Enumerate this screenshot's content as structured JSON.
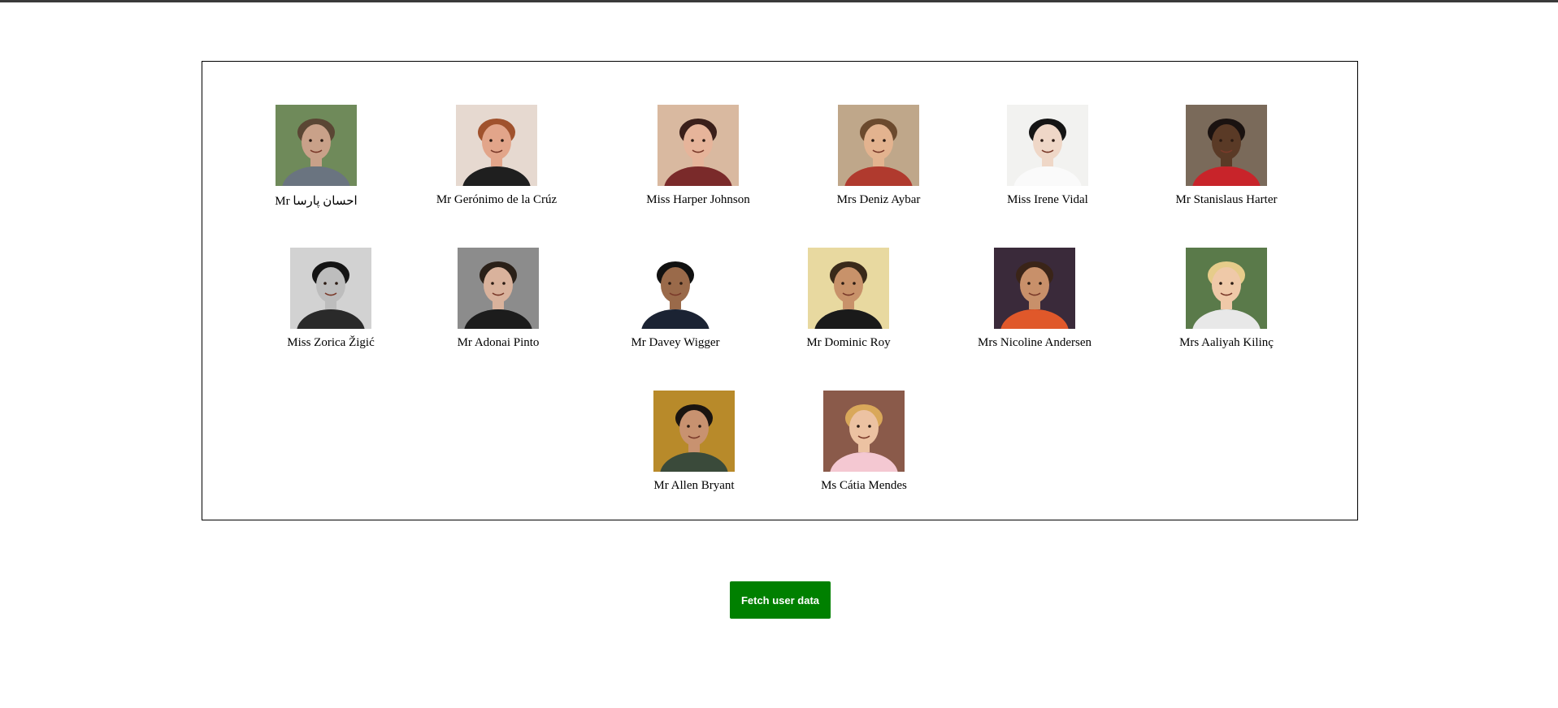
{
  "users": [
    {
      "name": "Mr احسان پارسا",
      "avatar": {
        "bg": "#6f8a5a",
        "skin": "#c9a189",
        "hair": "#5a4634",
        "shirt": "#6a7480"
      }
    },
    {
      "name": "Mr Gerónimo de la Crúz",
      "avatar": {
        "bg": "#e6d9d0",
        "skin": "#e2a58a",
        "hair": "#a0522d",
        "shirt": "#1f1f1f"
      }
    },
    {
      "name": "Miss Harper Johnson",
      "avatar": {
        "bg": "#d9b9a0",
        "skin": "#e6b49a",
        "hair": "#3a1f1a",
        "shirt": "#7a2a2a"
      }
    },
    {
      "name": "Mrs Deniz Aybar",
      "avatar": {
        "bg": "#bfa78a",
        "skin": "#e3b38f",
        "hair": "#6b4a2e",
        "shirt": "#b03a2e"
      }
    },
    {
      "name": "Miss Irene Vidal",
      "avatar": {
        "bg": "#f2f2f0",
        "skin": "#efd7c7",
        "hair": "#151515",
        "shirt": "#fafafa"
      }
    },
    {
      "name": "Mr Stanislaus Harter",
      "avatar": {
        "bg": "#7a6a5a",
        "skin": "#5a3a26",
        "hair": "#1a1210",
        "shirt": "#c8242a"
      }
    },
    {
      "name": "Miss Zorica Žigić",
      "avatar": {
        "bg": "#d2d2d2",
        "skin": "#bdbdbd",
        "hair": "#141414",
        "shirt": "#2a2a2a"
      }
    },
    {
      "name": "Mr Adonai Pinto",
      "avatar": {
        "bg": "#8c8c8c",
        "skin": "#d9b29c",
        "hair": "#2a2018",
        "shirt": "#1c1c1c"
      }
    },
    {
      "name": "Mr Davey Wigger",
      "avatar": {
        "bg": "#ffffff",
        "skin": "#9a6a4a",
        "hair": "#111111",
        "shirt": "#1b2333"
      }
    },
    {
      "name": "Mr Dominic Roy",
      "avatar": {
        "bg": "#e8d9a0",
        "skin": "#c8926a",
        "hair": "#3a2a1a",
        "shirt": "#1a1a1a"
      }
    },
    {
      "name": "Mrs Nicoline Andersen",
      "avatar": {
        "bg": "#3a2a3a",
        "skin": "#c8906a",
        "hair": "#3a2418",
        "shirt": "#e0582a"
      }
    },
    {
      "name": "Mrs Aaliyah Kilinç",
      "avatar": {
        "bg": "#5a7a4a",
        "skin": "#efc9a8",
        "hair": "#e6cc8a",
        "shirt": "#e8e8e8"
      }
    },
    {
      "name": "Mr Allen Bryant",
      "avatar": {
        "bg": "#b88a2a",
        "skin": "#c89270",
        "hair": "#1a1410",
        "shirt": "#3a4a3a"
      }
    },
    {
      "name": "Ms Cátia Mendes",
      "avatar": {
        "bg": "#8a5a4a",
        "skin": "#ecc2a2",
        "hair": "#d9a85a",
        "shirt": "#f4c8d2"
      }
    }
  ],
  "fetch_button": {
    "label": "Fetch user data",
    "color": "#008000"
  }
}
